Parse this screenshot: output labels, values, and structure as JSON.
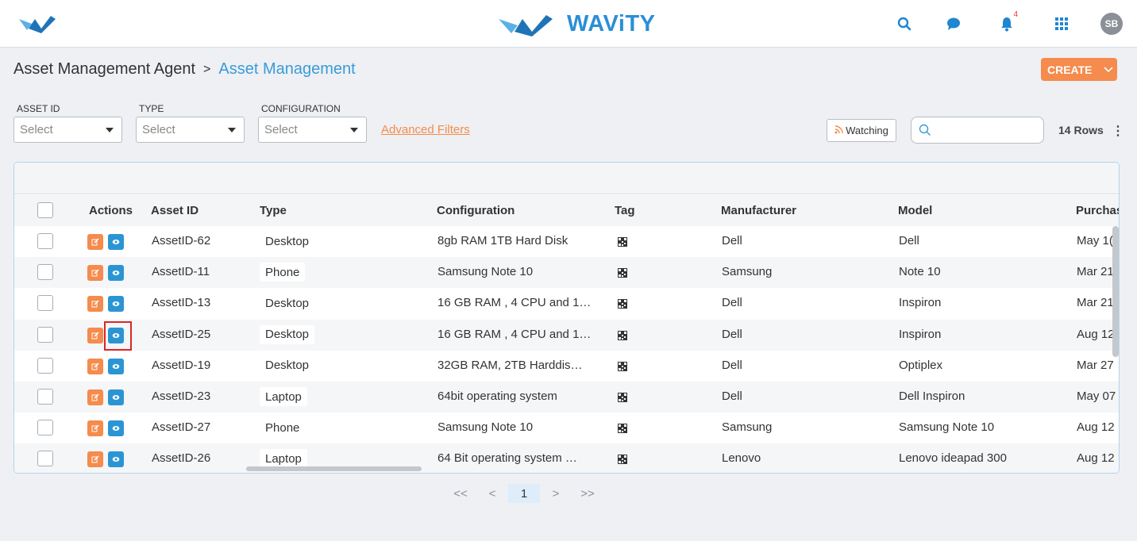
{
  "brand": {
    "name": "WAViTY"
  },
  "topbar": {
    "notification_count": "4",
    "avatar_initials": "SB"
  },
  "breadcrumb": {
    "root": "Asset Management Agent",
    "separator": ">",
    "current": "Asset Management"
  },
  "create_button": {
    "label": "CREATE"
  },
  "filters": [
    {
      "label": "ASSET ID",
      "placeholder": "Select"
    },
    {
      "label": "TYPE",
      "placeholder": "Select"
    },
    {
      "label": "CONFIGURATION",
      "placeholder": "Select"
    }
  ],
  "advanced_filters": "Advanced Filters",
  "watching": "Watching",
  "rows_count": "14 Rows",
  "table": {
    "headers": [
      "Actions",
      "Asset ID",
      "Type",
      "Configuration",
      "Tag",
      "Manufacturer",
      "Model",
      "Purchas"
    ],
    "rows": [
      {
        "asset_id": "AssetID-62",
        "type": "Desktop",
        "configuration": "8gb RAM 1TB Hard Disk",
        "manufacturer": "Dell",
        "model": "Dell",
        "purchase": "May 1("
      },
      {
        "asset_id": "AssetID-11",
        "type": "Phone",
        "configuration": "Samsung Note 10",
        "manufacturer": "Samsung",
        "model": "Note 10",
        "purchase": "Mar 21"
      },
      {
        "asset_id": "AssetID-13",
        "type": "Desktop",
        "configuration": "16 GB RAM , 4 CPU and 1…",
        "manufacturer": "Dell",
        "model": "Inspiron",
        "purchase": "Mar 21"
      },
      {
        "asset_id": "AssetID-25",
        "type": "Desktop",
        "configuration": "16 GB RAM , 4 CPU and 1…",
        "manufacturer": "Dell",
        "model": "Inspiron",
        "purchase": "Aug 12"
      },
      {
        "asset_id": "AssetID-19",
        "type": "Desktop",
        "configuration": "32GB RAM, 2TB Harddis…",
        "manufacturer": "Dell",
        "model": "Optiplex",
        "purchase": "Mar 27"
      },
      {
        "asset_id": "AssetID-23",
        "type": "Laptop",
        "configuration": "64bit operating system",
        "manufacturer": "Dell",
        "model": "Dell Inspiron",
        "purchase": "May 07"
      },
      {
        "asset_id": "AssetID-27",
        "type": "Phone",
        "configuration": "Samsung Note 10",
        "manufacturer": "Samsung",
        "model": "Samsung Note 10",
        "purchase": "Aug 12"
      },
      {
        "asset_id": "AssetID-26",
        "type": "Laptop",
        "configuration": "64 Bit operating system …",
        "manufacturer": "Lenovo",
        "model": "Lenovo ideapad 300",
        "purchase": "Aug 12"
      }
    ]
  },
  "pagination": {
    "first": "<<",
    "prev": "<",
    "current": "1",
    "next": ">",
    "last": ">>"
  },
  "colors": {
    "accent_orange": "#f58b4c",
    "accent_blue": "#2b95d4",
    "brand_blue": "#2a8fd6",
    "highlight_red": "#e02424"
  }
}
